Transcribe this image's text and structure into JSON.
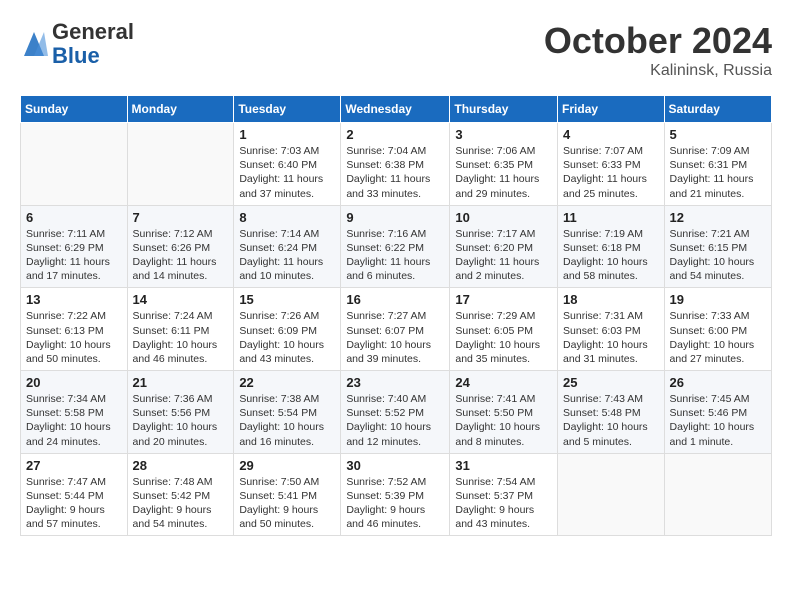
{
  "header": {
    "logo": {
      "general": "General",
      "blue": "Blue"
    },
    "title": "October 2024",
    "location": "Kalininsk, Russia"
  },
  "days_of_week": [
    "Sunday",
    "Monday",
    "Tuesday",
    "Wednesday",
    "Thursday",
    "Friday",
    "Saturday"
  ],
  "weeks": [
    [
      {
        "day": "",
        "info": ""
      },
      {
        "day": "",
        "info": ""
      },
      {
        "day": "1",
        "info": "Sunrise: 7:03 AM\nSunset: 6:40 PM\nDaylight: 11 hours and 37 minutes."
      },
      {
        "day": "2",
        "info": "Sunrise: 7:04 AM\nSunset: 6:38 PM\nDaylight: 11 hours and 33 minutes."
      },
      {
        "day": "3",
        "info": "Sunrise: 7:06 AM\nSunset: 6:35 PM\nDaylight: 11 hours and 29 minutes."
      },
      {
        "day": "4",
        "info": "Sunrise: 7:07 AM\nSunset: 6:33 PM\nDaylight: 11 hours and 25 minutes."
      },
      {
        "day": "5",
        "info": "Sunrise: 7:09 AM\nSunset: 6:31 PM\nDaylight: 11 hours and 21 minutes."
      }
    ],
    [
      {
        "day": "6",
        "info": "Sunrise: 7:11 AM\nSunset: 6:29 PM\nDaylight: 11 hours and 17 minutes."
      },
      {
        "day": "7",
        "info": "Sunrise: 7:12 AM\nSunset: 6:26 PM\nDaylight: 11 hours and 14 minutes."
      },
      {
        "day": "8",
        "info": "Sunrise: 7:14 AM\nSunset: 6:24 PM\nDaylight: 11 hours and 10 minutes."
      },
      {
        "day": "9",
        "info": "Sunrise: 7:16 AM\nSunset: 6:22 PM\nDaylight: 11 hours and 6 minutes."
      },
      {
        "day": "10",
        "info": "Sunrise: 7:17 AM\nSunset: 6:20 PM\nDaylight: 11 hours and 2 minutes."
      },
      {
        "day": "11",
        "info": "Sunrise: 7:19 AM\nSunset: 6:18 PM\nDaylight: 10 hours and 58 minutes."
      },
      {
        "day": "12",
        "info": "Sunrise: 7:21 AM\nSunset: 6:15 PM\nDaylight: 10 hours and 54 minutes."
      }
    ],
    [
      {
        "day": "13",
        "info": "Sunrise: 7:22 AM\nSunset: 6:13 PM\nDaylight: 10 hours and 50 minutes."
      },
      {
        "day": "14",
        "info": "Sunrise: 7:24 AM\nSunset: 6:11 PM\nDaylight: 10 hours and 46 minutes."
      },
      {
        "day": "15",
        "info": "Sunrise: 7:26 AM\nSunset: 6:09 PM\nDaylight: 10 hours and 43 minutes."
      },
      {
        "day": "16",
        "info": "Sunrise: 7:27 AM\nSunset: 6:07 PM\nDaylight: 10 hours and 39 minutes."
      },
      {
        "day": "17",
        "info": "Sunrise: 7:29 AM\nSunset: 6:05 PM\nDaylight: 10 hours and 35 minutes."
      },
      {
        "day": "18",
        "info": "Sunrise: 7:31 AM\nSunset: 6:03 PM\nDaylight: 10 hours and 31 minutes."
      },
      {
        "day": "19",
        "info": "Sunrise: 7:33 AM\nSunset: 6:00 PM\nDaylight: 10 hours and 27 minutes."
      }
    ],
    [
      {
        "day": "20",
        "info": "Sunrise: 7:34 AM\nSunset: 5:58 PM\nDaylight: 10 hours and 24 minutes."
      },
      {
        "day": "21",
        "info": "Sunrise: 7:36 AM\nSunset: 5:56 PM\nDaylight: 10 hours and 20 minutes."
      },
      {
        "day": "22",
        "info": "Sunrise: 7:38 AM\nSunset: 5:54 PM\nDaylight: 10 hours and 16 minutes."
      },
      {
        "day": "23",
        "info": "Sunrise: 7:40 AM\nSunset: 5:52 PM\nDaylight: 10 hours and 12 minutes."
      },
      {
        "day": "24",
        "info": "Sunrise: 7:41 AM\nSunset: 5:50 PM\nDaylight: 10 hours and 8 minutes."
      },
      {
        "day": "25",
        "info": "Sunrise: 7:43 AM\nSunset: 5:48 PM\nDaylight: 10 hours and 5 minutes."
      },
      {
        "day": "26",
        "info": "Sunrise: 7:45 AM\nSunset: 5:46 PM\nDaylight: 10 hours and 1 minute."
      }
    ],
    [
      {
        "day": "27",
        "info": "Sunrise: 7:47 AM\nSunset: 5:44 PM\nDaylight: 9 hours and 57 minutes."
      },
      {
        "day": "28",
        "info": "Sunrise: 7:48 AM\nSunset: 5:42 PM\nDaylight: 9 hours and 54 minutes."
      },
      {
        "day": "29",
        "info": "Sunrise: 7:50 AM\nSunset: 5:41 PM\nDaylight: 9 hours and 50 minutes."
      },
      {
        "day": "30",
        "info": "Sunrise: 7:52 AM\nSunset: 5:39 PM\nDaylight: 9 hours and 46 minutes."
      },
      {
        "day": "31",
        "info": "Sunrise: 7:54 AM\nSunset: 5:37 PM\nDaylight: 9 hours and 43 minutes."
      },
      {
        "day": "",
        "info": ""
      },
      {
        "day": "",
        "info": ""
      }
    ]
  ]
}
